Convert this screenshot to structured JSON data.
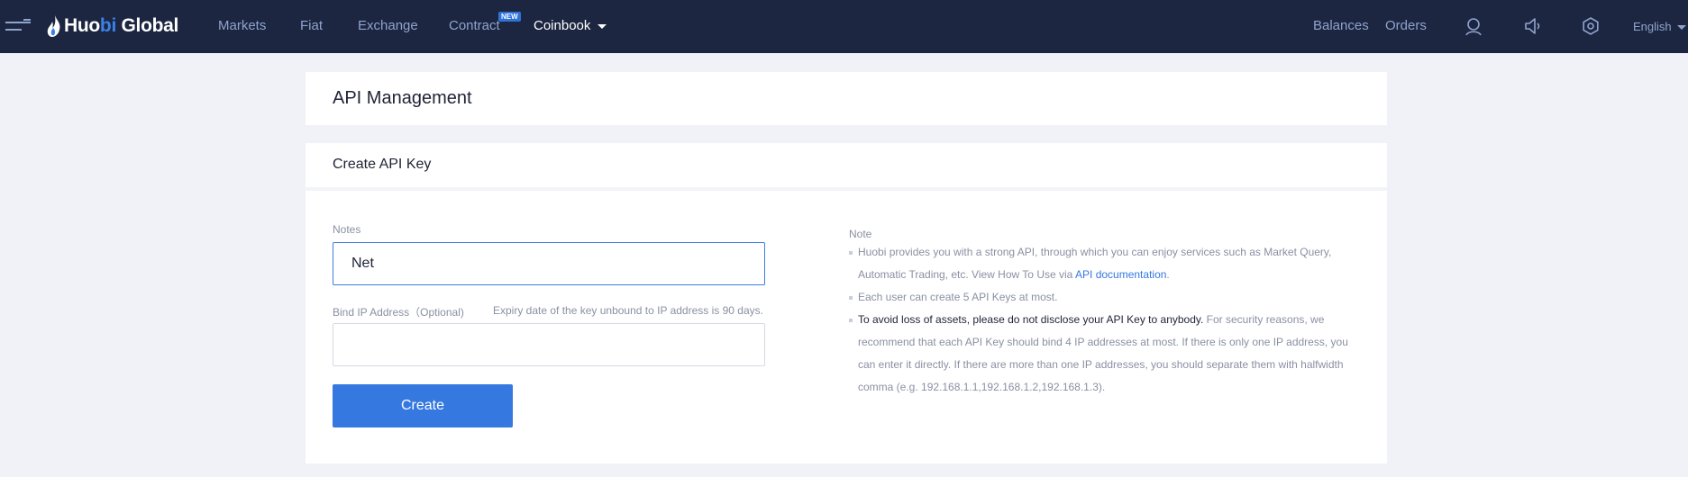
{
  "brand": {
    "name_part1": "Huo",
    "name_part2": "bi",
    "name_part3": " Global",
    "accent": "#3b82e6",
    "nav_bg": "#1c2640"
  },
  "nav": {
    "links": [
      {
        "label": "Markets"
      },
      {
        "label": "Fiat"
      },
      {
        "label": "Exchange"
      },
      {
        "label": "Contract"
      }
    ],
    "new_badge": "NEW",
    "coinbook": "Coinbook",
    "balances": "Balances",
    "orders": "Orders",
    "language": "English",
    "icons": [
      "menu-icon",
      "user-icon",
      "speaker-icon",
      "settings-icon"
    ]
  },
  "page": {
    "title": "API Management",
    "section_title": "Create API Key"
  },
  "form": {
    "notes_label": "Notes",
    "notes_value": "Net",
    "bind_ip_label": "Bind IP Address（Optional)",
    "expiry_hint": "Expiry date of the key unbound to IP address is 90 days.",
    "ip_value": "",
    "create_button": "Create",
    "button_color": "#3478e0"
  },
  "note": {
    "title": "Note",
    "item1_text": "Huobi provides you with a strong API, through which you can enjoy services such as Market Query, Automatic Trading, etc. View How To Use via ",
    "item1_link": "API documentation",
    "item1_end": ".",
    "item2": "Each user can create 5 API Keys at most.",
    "item3_strong": "To avoid loss of assets, please do not disclose your API Key to anybody.",
    "item3_rest": " For security reasons, we recommend that each API Key should bind 4 IP addresses at most. If there is only one IP address, you can enter it directly. If there are more than one IP addresses, you should separate them with halfwidth comma (e.g. 192.168.1.1,192.168.1.2,192.168.1.3)."
  }
}
